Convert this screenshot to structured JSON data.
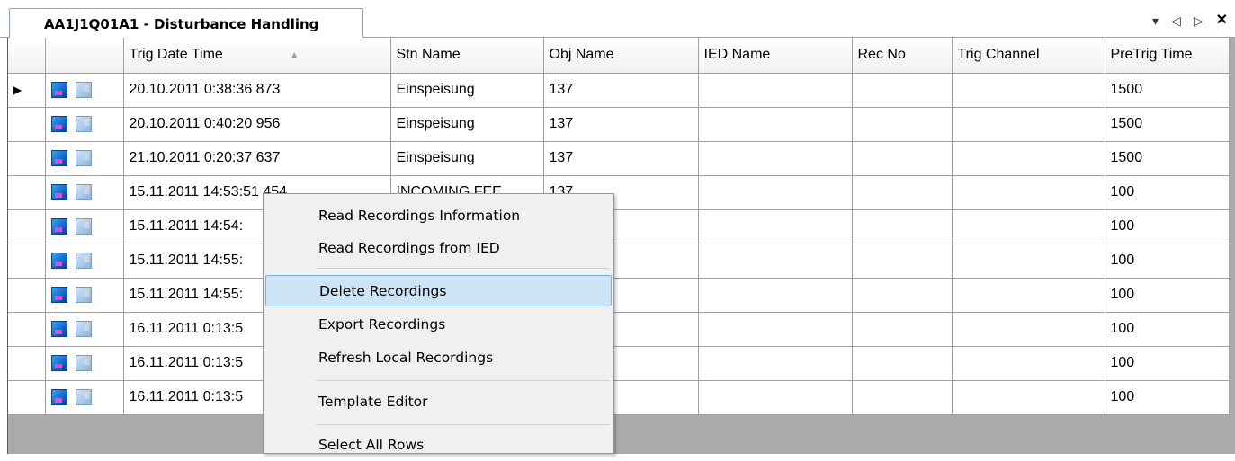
{
  "tab": {
    "title": "AA1J1Q01A1 - Disturbance Handling",
    "controls": {
      "dropdown": "▾",
      "prev": "◁",
      "next": "▷",
      "close": "✕"
    }
  },
  "grid": {
    "columns": [
      "",
      "Trig Date Time",
      "Stn Name",
      "Obj Name",
      "IED Name",
      "Rec No",
      "Trig Channel",
      "PreTrig Time"
    ],
    "sort_indicator": "▲",
    "rows": [
      {
        "trig": "20.10.2011 0:38:36 873",
        "stn": "Einspeisung",
        "obj": "137",
        "ied": "",
        "rec": "",
        "chan": "",
        "pre": "1500"
      },
      {
        "trig": "20.10.2011 0:40:20 956",
        "stn": "Einspeisung",
        "obj": "137",
        "ied": "",
        "rec": "",
        "chan": "",
        "pre": "1500"
      },
      {
        "trig": "21.10.2011 0:20:37 637",
        "stn": "Einspeisung",
        "obj": "137",
        "ied": "",
        "rec": "",
        "chan": "",
        "pre": "1500"
      },
      {
        "trig": "15.11.2011 14:53:51 454",
        "stn": "INCOMING FEE",
        "obj": "137",
        "ied": "",
        "rec": "",
        "chan": "",
        "pre": "100"
      },
      {
        "trig": "15.11.2011 14:54:",
        "stn": "",
        "obj": "",
        "ied": "",
        "rec": "",
        "chan": "",
        "pre": "100"
      },
      {
        "trig": "15.11.2011 14:55:",
        "stn": "",
        "obj": "",
        "ied": "",
        "rec": "",
        "chan": "",
        "pre": "100"
      },
      {
        "trig": "15.11.2011 14:55:",
        "stn": "",
        "obj": "",
        "ied": "",
        "rec": "",
        "chan": "",
        "pre": "100"
      },
      {
        "trig": "16.11.2011 0:13:5",
        "stn": "",
        "obj": "",
        "ied": "",
        "rec": "",
        "chan": "",
        "pre": "100"
      },
      {
        "trig": "16.11.2011 0:13:5",
        "stn": "",
        "obj": "",
        "ied": "",
        "rec": "",
        "chan": "",
        "pre": "100"
      },
      {
        "trig": "16.11.2011 0:13:5",
        "stn": "",
        "obj": "",
        "ied": "",
        "rec": "",
        "chan": "",
        "pre": "100"
      }
    ],
    "current_row_marker": "▶",
    "row_icons": [
      "disturbance-record-icon",
      "local-record-icon"
    ]
  },
  "context_menu": {
    "items": [
      {
        "label": "Read Recordings Information",
        "active": false
      },
      {
        "label": "Read Recordings from IED",
        "active": false
      },
      {
        "label": "Delete Recordings",
        "active": true
      },
      {
        "label": "Export Recordings",
        "active": false
      },
      {
        "label": "Refresh Local Recordings",
        "active": false
      },
      {
        "label": "Template Editor",
        "active": false
      },
      {
        "label": "Select All Rows",
        "active": false
      }
    ],
    "highlight_color": "#cce4f7"
  }
}
